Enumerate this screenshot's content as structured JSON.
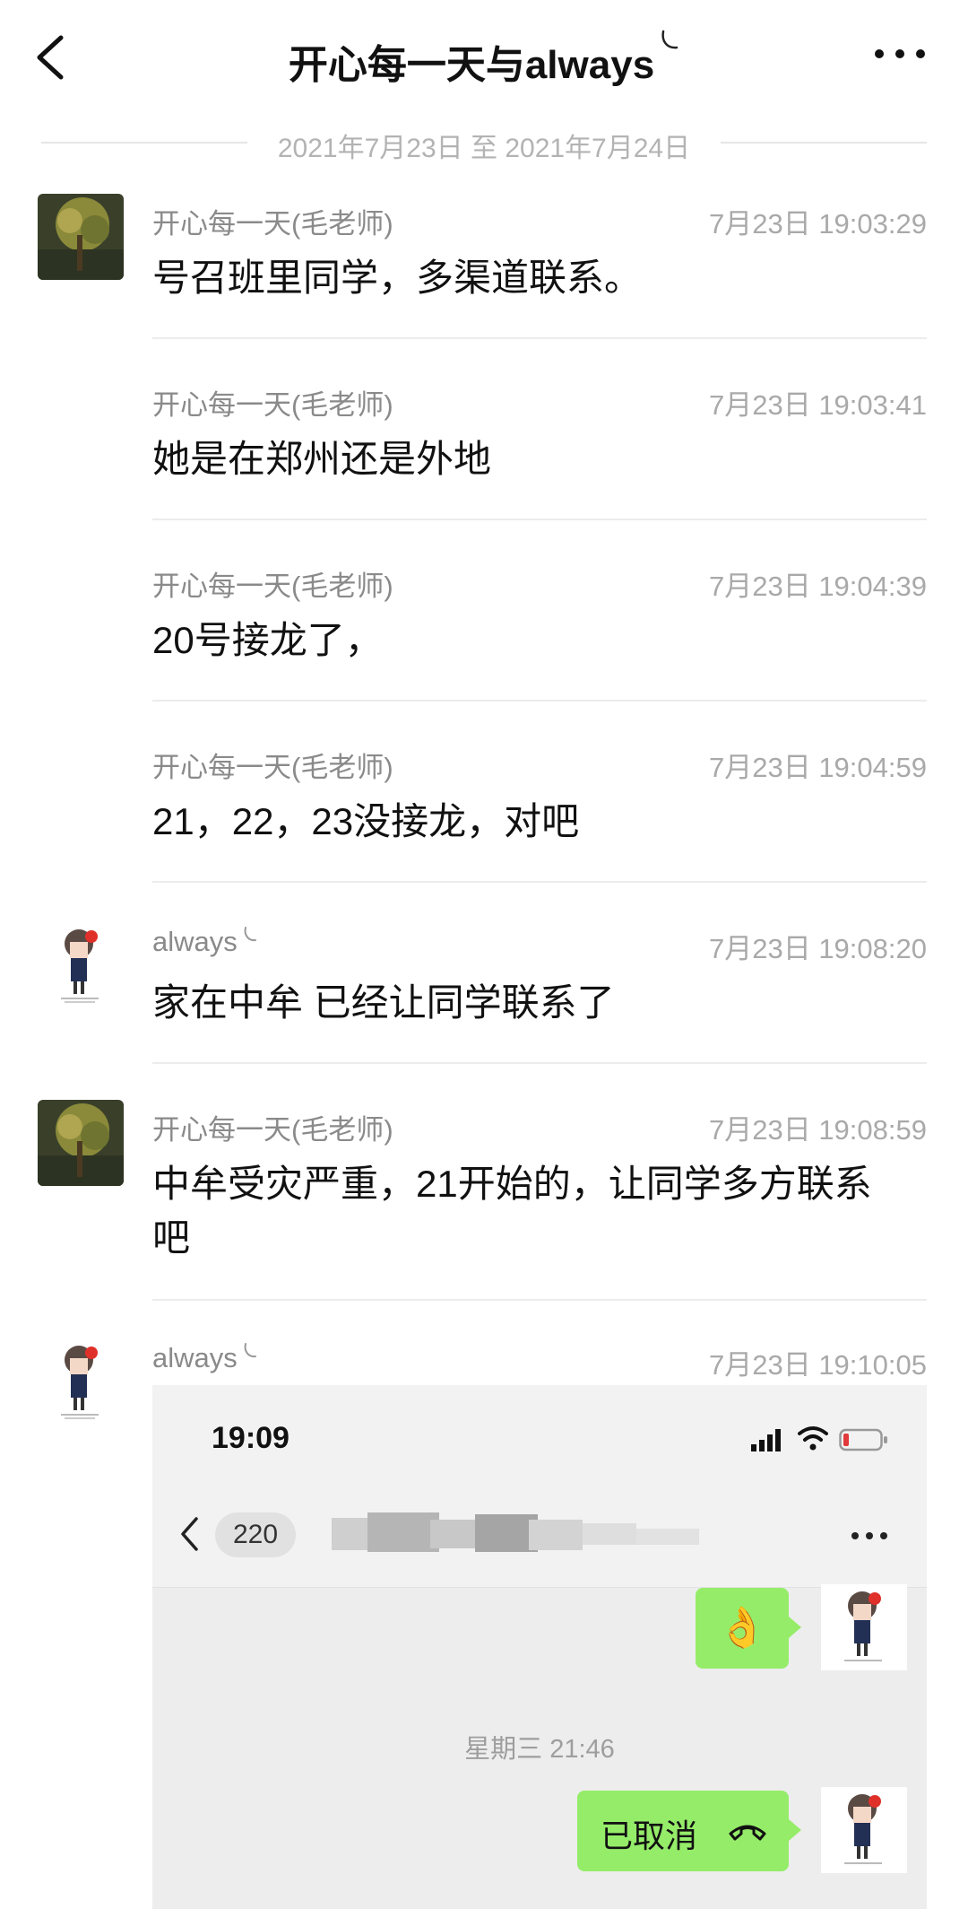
{
  "header": {
    "title": "开心每一天与always",
    "back_icon": "chevron-left-icon",
    "more_icon": "more-dots-icon"
  },
  "date_range": "2021年7月23日 至 2021年7月24日",
  "messages": [
    {
      "sender": "开心每一天(毛老师)",
      "time": "7月23日 19:03:29",
      "text": "号召班里同学，多渠道联系。"
    },
    {
      "sender": "开心每一天(毛老师)",
      "time": "7月23日 19:03:41",
      "text": "她是在郑州还是外地"
    },
    {
      "sender": "开心每一天(毛老师)",
      "time": "7月23日 19:04:39",
      "text": "20号接龙了，"
    },
    {
      "sender": "开心每一天(毛老师)",
      "time": "7月23日 19:04:59",
      "text": "21，22，23没接龙，对吧"
    },
    {
      "sender": "always",
      "time": "7月23日 19:08:20",
      "text": "家在中牟 已经让同学联系了"
    },
    {
      "sender": "开心每一天(毛老师)",
      "time": "7月23日 19:08:59",
      "text": "中牟受灾严重，21开始的，让同学多方联系吧"
    },
    {
      "sender": "always",
      "time": "7月23日 19:10:05",
      "text": ""
    }
  ],
  "embedded_screenshot": {
    "clock": "19:09",
    "unread_badge": "220",
    "time_divider": "星期三 21:46",
    "ok_emoji": "👌",
    "call_status": "已取消",
    "colors": {
      "bubble": "#95ec69"
    }
  }
}
